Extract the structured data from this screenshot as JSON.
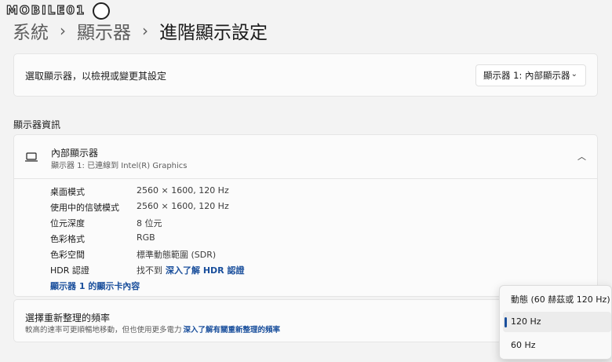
{
  "watermark": {
    "text": "MOBILE01"
  },
  "breadcrumb": {
    "items": [
      "系統",
      "顯示器",
      "進階顯示設定"
    ]
  },
  "display_select": {
    "label": "選取顯示器，以檢視或變更其設定",
    "dropdown_value": "顯示器 1: 內部顯示器"
  },
  "section": {
    "title": "顯示器資訊"
  },
  "display_info": {
    "name": "內部顯示器",
    "subtitle": "顯示器 1: 已連線到 Intel(R) Graphics",
    "rows": [
      {
        "key": "桌面模式",
        "value": "2560 × 1600, 120 Hz"
      },
      {
        "key": "使用中的信號模式",
        "value": "2560 × 1600, 120 Hz"
      },
      {
        "key": "位元深度",
        "value": "8 位元"
      },
      {
        "key": "色彩格式",
        "value": "RGB"
      },
      {
        "key": "色彩空間",
        "value": "標準動態範圍 (SDR)"
      },
      {
        "key": "HDR 認證",
        "value": "找不到",
        "link": "深入了解 HDR 認證"
      }
    ],
    "adapter_link": "顯示器 1 的顯示卡內容"
  },
  "refresh": {
    "title": "選擇重新整理的頻率",
    "subtitle": "較高的速率可更順暢地移動，但也使用更多電力",
    "link": "深入了解有關重新整理的頻率"
  },
  "refresh_options": {
    "items": [
      "動態 (60 赫茲或 120 Hz)",
      "120 Hz",
      "60 Hz"
    ],
    "selected": "120 Hz"
  },
  "colors": {
    "accent": "#1a4f9c",
    "background": "#f3f3f3",
    "card": "#fbfbfb"
  }
}
